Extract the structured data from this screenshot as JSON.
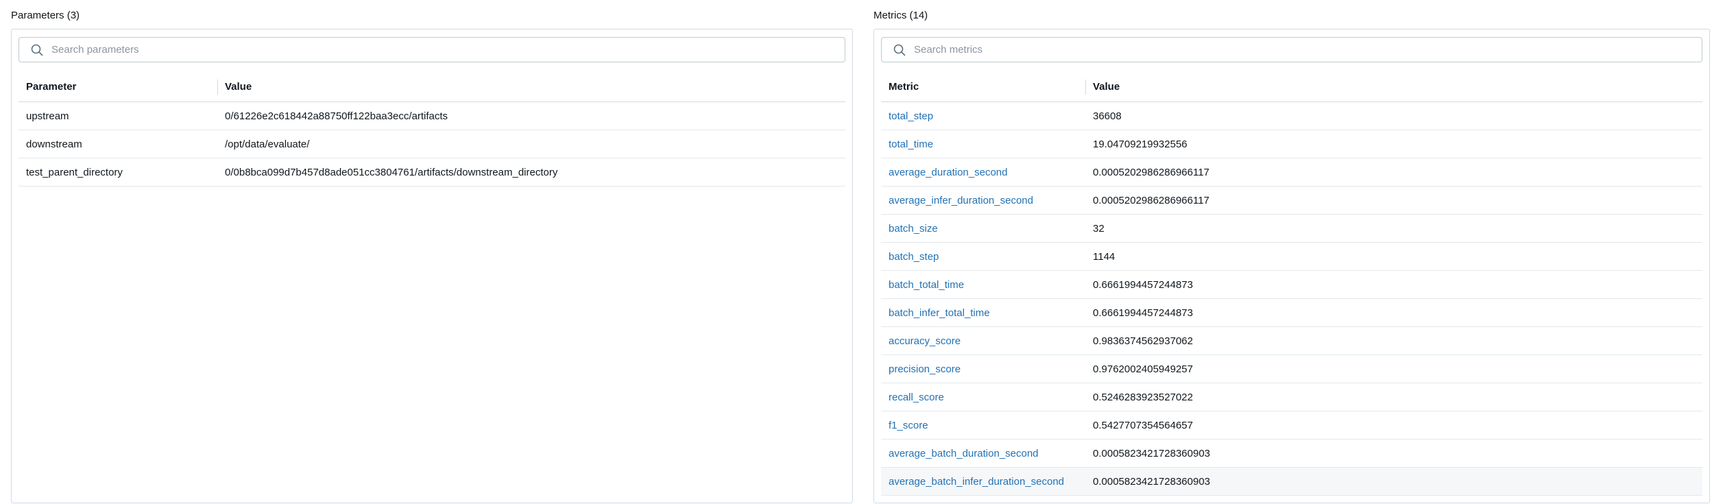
{
  "parameters": {
    "title": "Parameters (3)",
    "search_placeholder": "Search parameters",
    "headers": [
      "Parameter",
      "Value"
    ],
    "rows": [
      {
        "name": "upstream",
        "value": "0/61226e2c618442a88750ff122baa3ecc/artifacts"
      },
      {
        "name": "downstream",
        "value": "/opt/data/evaluate/"
      },
      {
        "name": "test_parent_directory",
        "value": "0/0b8bca099d7b457d8ade051cc3804761/artifacts/downstream_directory"
      }
    ]
  },
  "metrics": {
    "title": "Metrics (14)",
    "search_placeholder": "Search metrics",
    "headers": [
      "Metric",
      "Value"
    ],
    "rows": [
      {
        "name": "total_step",
        "value": "36608"
      },
      {
        "name": "total_time",
        "value": "19.04709219932556"
      },
      {
        "name": "average_duration_second",
        "value": "0.0005202986286966117"
      },
      {
        "name": "average_infer_duration_second",
        "value": "0.0005202986286966117"
      },
      {
        "name": "batch_size",
        "value": "32"
      },
      {
        "name": "batch_step",
        "value": "1144"
      },
      {
        "name": "batch_total_time",
        "value": "0.6661994457244873"
      },
      {
        "name": "batch_infer_total_time",
        "value": "0.6661994457244873"
      },
      {
        "name": "accuracy_score",
        "value": "0.9836374562937062"
      },
      {
        "name": "precision_score",
        "value": "0.9762002405949257"
      },
      {
        "name": "recall_score",
        "value": "0.5246283923527022"
      },
      {
        "name": "f1_score",
        "value": "0.5427707354564657"
      },
      {
        "name": "average_batch_duration_second",
        "value": "0.0005823421728360903"
      },
      {
        "name": "average_batch_infer_duration_second",
        "value": "0.0005823421728360903"
      }
    ]
  },
  "colors": {
    "link": "#2272b4",
    "border": "#d1d9e1",
    "row_hover": "#f6f7f9"
  },
  "icons": {
    "search": "search-icon"
  }
}
